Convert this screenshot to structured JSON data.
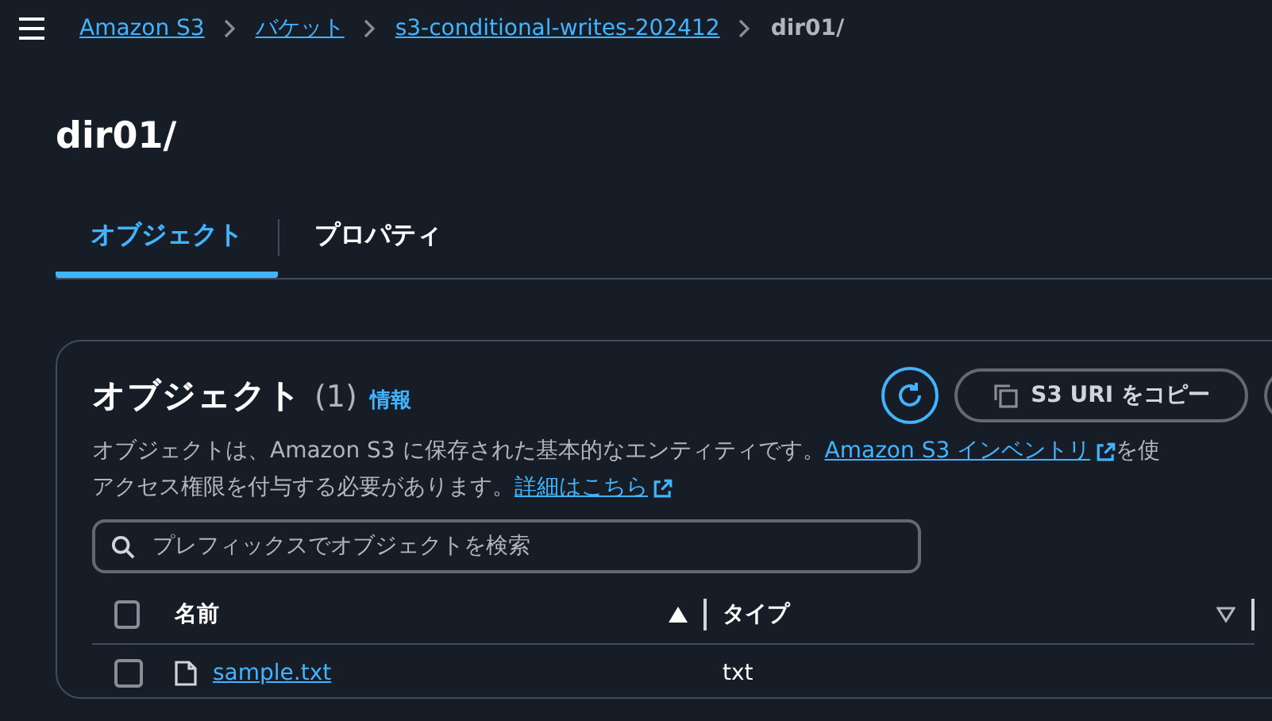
{
  "breadcrumbs": [
    {
      "label": "Amazon S3",
      "link": true
    },
    {
      "label": "バケット",
      "link": true
    },
    {
      "label": "s3-conditional-writes-202412",
      "link": true
    },
    {
      "label": "dir01/",
      "link": false
    }
  ],
  "page_title": "dir01/",
  "tabs": [
    {
      "label": "オブジェクト",
      "selected": true
    },
    {
      "label": "プロパティ",
      "selected": false
    }
  ],
  "panel": {
    "title": "オブジェクト",
    "count": "(1)",
    "info_link": "情報",
    "copy_button": "S3 URI をコピー",
    "description": [
      {
        "text": "オブジェクトは、Amazon S3 に保存された基本的なエンティティです。",
        "link": "Amazon S3 インベントリ",
        "after": "を使"
      },
      {
        "text": "アクセス権限を付与する必要があります。",
        "link": "詳細はこちら"
      }
    ],
    "search": {
      "placeholder": "プレフィックスでオブジェクトを検索"
    },
    "select_all_checked": false,
    "columns": [
      {
        "label": "名前",
        "sorted": true
      },
      {
        "label": "タイプ",
        "sorted": false
      }
    ],
    "rows": [
      {
        "name": "sample.txt",
        "type": "txt",
        "checked": false
      }
    ]
  }
}
